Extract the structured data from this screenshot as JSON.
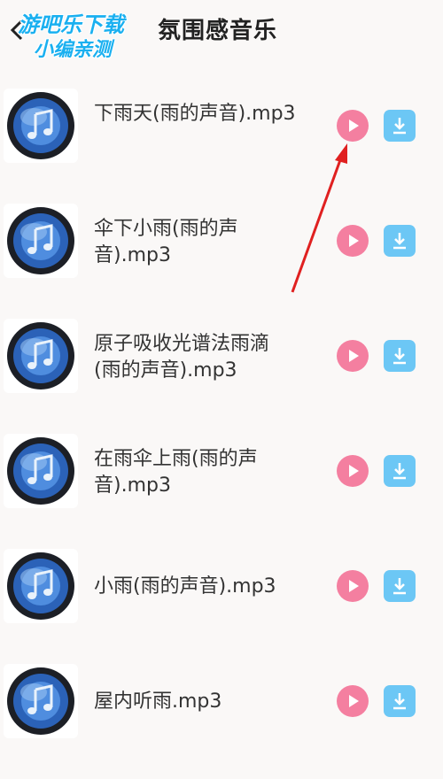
{
  "header": {
    "title": "氛围感音乐",
    "back_icon": "chevron-left-icon",
    "watermark_line1": "游吧乐下载",
    "watermark_line2": "小编亲测"
  },
  "songs": [
    {
      "name": "下雨天(雨的声音).mp3"
    },
    {
      "name": "伞下小雨(雨的声音).mp3"
    },
    {
      "name": "原子吸收光谱法雨滴(雨的声音).mp3"
    },
    {
      "name": "在雨伞上雨(雨的声音).mp3"
    },
    {
      "name": "小雨(雨的声音).mp3"
    },
    {
      "name": "屋内听雨.mp3"
    }
  ],
  "icons": {
    "album": "music-note-album-icon",
    "play": "play-icon",
    "download": "download-icon"
  },
  "colors": {
    "play_button": "#f47fa0",
    "download_button": "#6cc7f5",
    "annotation_arrow": "#e02020",
    "watermark": "#1ab0f0"
  }
}
